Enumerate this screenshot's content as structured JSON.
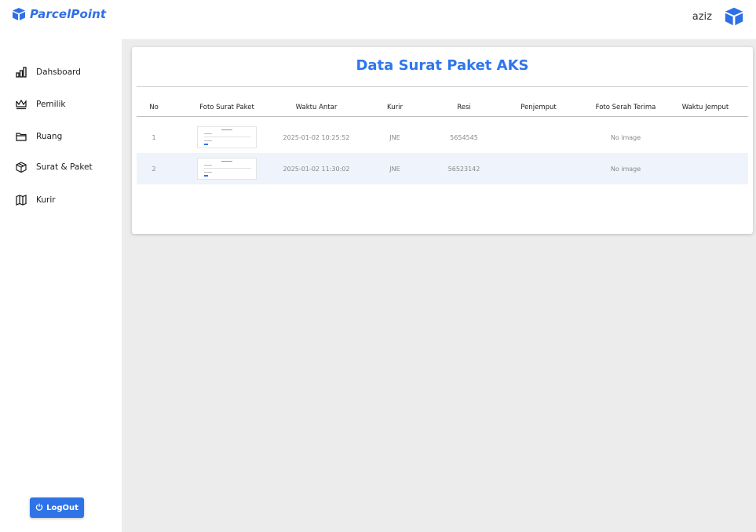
{
  "brand": {
    "name": "ParcelPoint",
    "icon": "package-cube-icon",
    "color": "#2f6fe6"
  },
  "user": {
    "name": "aziz",
    "avatar_icon": "package-cube-icon"
  },
  "sidebar": {
    "items": [
      {
        "label": "Dahsboard",
        "icon": "bar-chart-icon"
      },
      {
        "label": "Pemilik",
        "icon": "crown-icon"
      },
      {
        "label": "Ruang",
        "icon": "folder-icon"
      },
      {
        "label": "Surat & Paket",
        "icon": "package-icon"
      },
      {
        "label": "Kurir",
        "icon": "map-icon"
      }
    ],
    "logout_label": "LogOut"
  },
  "main": {
    "title": "Data Surat Paket AKS",
    "accent": "#2f76ec",
    "table": {
      "columns": [
        "No",
        "Foto Surat Paket",
        "Waktu Antar",
        "Kurir",
        "Resi",
        "Penjemput",
        "Foto Serah Terima",
        "Waktu Jemput"
      ],
      "rows": [
        {
          "no": "1",
          "waktu_antar": "2025-01-02 10:25:52",
          "kurir": "JNE",
          "resi": "5654545",
          "penjemput": "",
          "foto_serah_terima": "No image",
          "waktu_jemput": ""
        },
        {
          "no": "2",
          "waktu_antar": "2025-01-02 11:30:02",
          "kurir": "JNE",
          "resi": "56523142",
          "penjemput": "",
          "foto_serah_terima": "No image",
          "waktu_jemput": ""
        }
      ]
    }
  }
}
